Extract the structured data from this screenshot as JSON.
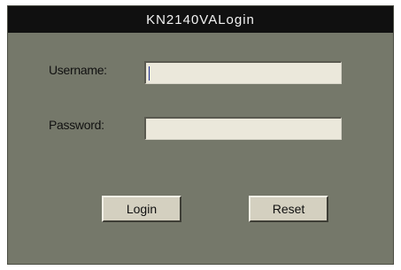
{
  "window": {
    "title": "KN2140VALogin"
  },
  "form": {
    "username_label": "Username:",
    "username_value": "",
    "password_label": "Password:",
    "password_value": ""
  },
  "buttons": {
    "login_label": "Login",
    "reset_label": "Reset"
  },
  "colors": {
    "titlebar": "#101010",
    "panel": "#75786a",
    "field": "#ebe8db",
    "button": "#d4d0c0"
  }
}
